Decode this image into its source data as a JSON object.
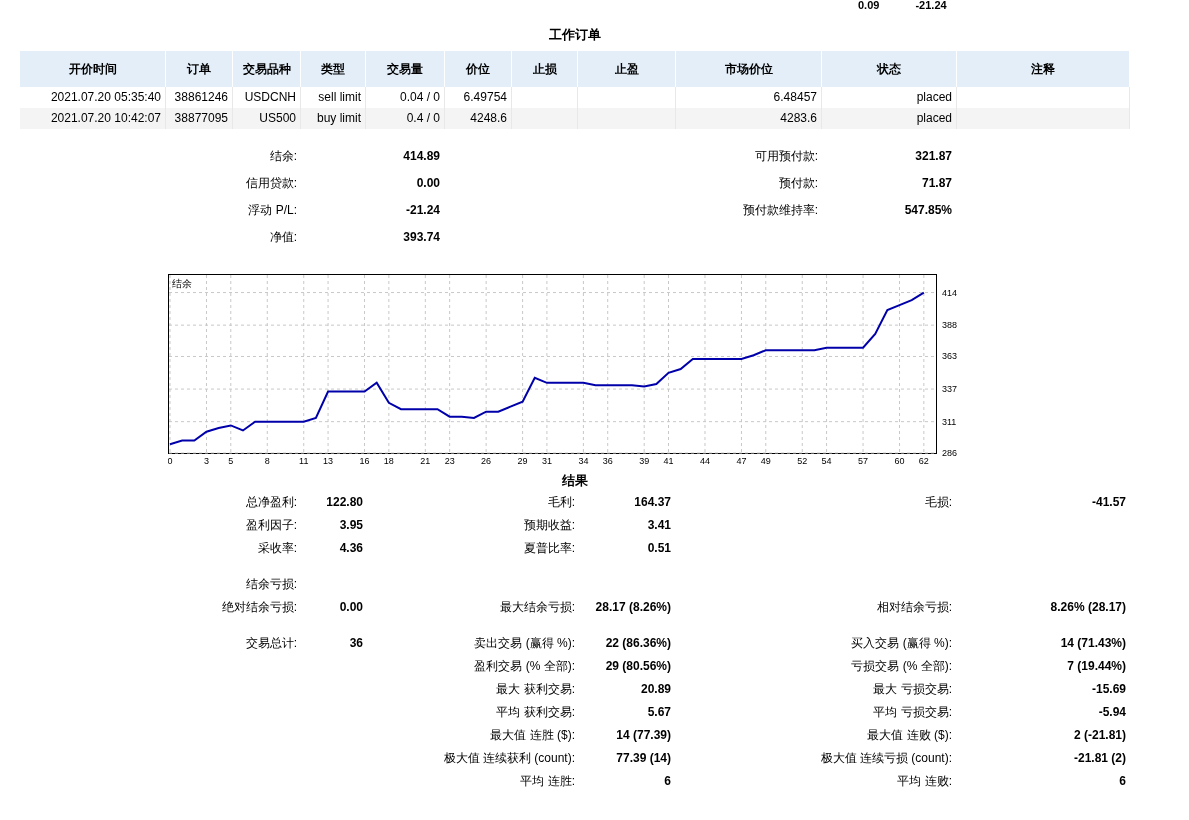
{
  "top_cut": [
    "0.09",
    "-21.24"
  ],
  "orders": {
    "title": "工作订单",
    "columns": [
      "开价时间",
      "订单",
      "交易品种",
      "类型",
      "交易量",
      "价位",
      "止损",
      "止盈",
      "市场价位",
      "状态",
      "注释"
    ],
    "rows": [
      {
        "cells": [
          "2021.07.20 05:35:40",
          "38861246",
          "USDCNH",
          "sell limit",
          "0.04 / 0",
          "6.49754",
          "",
          "",
          "6.48457",
          "placed",
          ""
        ]
      },
      {
        "cells": [
          "2021.07.20 10:42:07",
          "38877095",
          "US500",
          "buy limit",
          "0.4 / 0",
          "4248.6",
          "",
          "",
          "4283.6",
          "placed",
          ""
        ]
      }
    ]
  },
  "summary": [
    {
      "left": {
        "label": "结余:",
        "value": "414.89"
      },
      "right": {
        "label": "可用预付款:",
        "value": "321.87"
      }
    },
    {
      "left": {
        "label": "信用贷款:",
        "value": "0.00"
      },
      "right": {
        "label": "预付款:",
        "value": "71.87"
      }
    },
    {
      "left": {
        "label": "浮动 P/L:",
        "value": "-21.24"
      },
      "right": {
        "label": "预付款维持率:",
        "value": "547.85%"
      }
    },
    {
      "left": {
        "label": "净值:",
        "value": "393.74"
      }
    }
  ],
  "chart_data": {
    "type": "line",
    "title": "结余",
    "x": [
      0,
      1,
      2,
      3,
      4,
      5,
      6,
      7,
      8,
      9,
      10,
      11,
      12,
      13,
      14,
      15,
      16,
      17,
      18,
      19,
      20,
      21,
      22,
      23,
      24,
      25,
      26,
      27,
      28,
      29,
      30,
      31,
      32,
      33,
      34,
      35,
      36,
      37,
      38,
      39,
      40,
      41,
      42,
      43,
      44,
      45,
      46,
      47,
      48,
      49,
      50,
      51,
      52,
      53,
      54,
      55,
      56,
      57,
      58,
      59,
      60,
      61,
      62
    ],
    "grid": true,
    "series": [
      {
        "color": "#0000aa",
        "values": [
          293,
          296,
          296,
          303,
          306,
          308,
          304,
          311,
          311,
          311,
          311,
          311,
          314,
          335,
          335,
          335,
          335,
          342,
          326,
          321,
          321,
          321,
          321,
          315,
          315,
          314,
          319,
          319,
          323,
          327,
          346,
          342,
          342,
          342,
          342,
          340,
          340,
          340,
          340,
          339,
          341,
          350,
          353,
          361,
          361,
          361,
          361,
          361,
          364,
          368,
          368,
          368,
          368,
          368,
          370,
          370,
          370,
          370,
          381,
          400,
          404,
          408,
          414
        ]
      }
    ],
    "xlim": [
      0,
      63
    ],
    "ylim": [
      286,
      428
    ],
    "xticks": [
      0,
      3,
      5,
      8,
      11,
      13,
      16,
      18,
      21,
      23,
      26,
      29,
      31,
      34,
      36,
      39,
      41,
      44,
      47,
      49,
      52,
      54,
      57,
      60,
      62
    ],
    "yticks": [
      286,
      311,
      337,
      363,
      388,
      414
    ]
  },
  "results": {
    "title": "结果",
    "groups": [
      [
        {
          "left": {
            "label": "总净盈利:",
            "value": "122.80"
          },
          "middle": {
            "label": "毛利:",
            "value": "164.37"
          },
          "right": {
            "label": "毛损:",
            "value": "-41.57"
          }
        },
        {
          "left": {
            "label": "盈利因子:",
            "value": "3.95"
          },
          "middle": {
            "label": "预期收益:",
            "value": "3.41"
          }
        },
        {
          "left": {
            "label": "采收率:",
            "value": "4.36"
          },
          "middle": {
            "label": "夏普比率:",
            "value": "0.51"
          }
        }
      ],
      [
        {
          "left": {
            "label": "结余亏损:"
          }
        },
        {
          "left": {
            "label": "绝对结余亏损:",
            "value": "0.00"
          },
          "middle": {
            "label": "最大结余亏损:",
            "value": "28.17 (8.26%)"
          },
          "right": {
            "label": "相对结余亏损:",
            "value": "8.26% (28.17)"
          }
        }
      ],
      [
        {
          "left": {
            "label": "交易总计:",
            "value": "36"
          },
          "middle": {
            "label": "卖出交易 (赢得 %):",
            "value": "22 (86.36%)"
          },
          "right": {
            "label": "买入交易 (赢得 %):",
            "value": "14 (71.43%)"
          }
        },
        {
          "middle": {
            "label": "盈利交易 (% 全部):",
            "value": "29 (80.56%)"
          },
          "right": {
            "label": "亏损交易 (% 全部):",
            "value": "7 (19.44%)"
          }
        },
        {
          "middle": {
            "label": "最大 获利交易:",
            "value": "20.89"
          },
          "right": {
            "label": "最大 亏损交易:",
            "value": "-15.69"
          }
        },
        {
          "middle": {
            "label": "平均 获利交易:",
            "value": "5.67"
          },
          "right": {
            "label": "平均 亏损交易:",
            "value": "-5.94"
          }
        },
        {
          "middle": {
            "label": "最大值 连胜 ($):",
            "value": "14 (77.39)"
          },
          "right": {
            "label": "最大值 连败 ($):",
            "value": "2 (-21.81)"
          }
        },
        {
          "middle": {
            "label": "极大值 连续获利 (count):",
            "value": "77.39 (14)"
          },
          "right": {
            "label": "极大值 连续亏损 (count):",
            "value": "-21.81 (2)"
          }
        },
        {
          "middle": {
            "label": "平均 连胜:",
            "value": "6"
          },
          "right": {
            "label": "平均 连败:",
            "value": "6"
          }
        }
      ]
    ]
  }
}
